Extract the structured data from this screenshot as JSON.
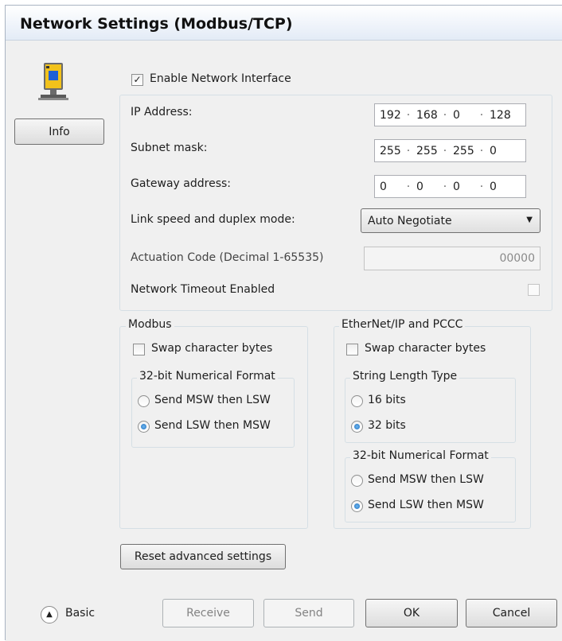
{
  "window": {
    "title": "Network Settings  (Modbus/TCP)"
  },
  "sidebar": {
    "info_label": "Info"
  },
  "network": {
    "enable_label": "Enable Network Interface",
    "enable_checked": true,
    "ip_label": "IP Address:",
    "ip": [
      "192",
      "168",
      "0",
      "128"
    ],
    "subnet_label": "Subnet mask:",
    "subnet": [
      "255",
      "255",
      "255",
      "0"
    ],
    "gateway_label": "Gateway address:",
    "gateway": [
      "0",
      "0",
      "0",
      "0"
    ],
    "link_label": "Link speed and duplex mode:",
    "link_value": "Auto Negotiate",
    "actuation_label": "Actuation Code (Decimal 1-65535)",
    "actuation_value": "00000",
    "timeout_label": "Network Timeout Enabled",
    "timeout_checked": false
  },
  "modbus": {
    "title": "Modbus",
    "swap_label": "Swap character bytes",
    "swap_checked": false,
    "format_title": "32-bit Numerical Format",
    "opt_msw": "Send MSW then LSW",
    "opt_lsw": "Send LSW then MSW",
    "selected": "lsw"
  },
  "ethernetip": {
    "title": "EtherNet/IP and PCCC",
    "swap_label": "Swap character bytes",
    "swap_checked": false,
    "string_title": "String Length Type",
    "opt_16": "16 bits",
    "opt_32": "32 bits",
    "string_selected": "32",
    "format_title": "32-bit Numerical Format",
    "opt_msw": "Send MSW then LSW",
    "opt_lsw": "Send LSW then MSW",
    "format_selected": "lsw"
  },
  "footer": {
    "reset_label": "Reset advanced settings",
    "basic_label": "Basic",
    "receive_label": "Receive",
    "send_label": "Send",
    "ok_label": "OK",
    "cancel_label": "Cancel"
  },
  "colors": {
    "accent": "#1e6fc0",
    "panel_border": "#d5dfe5",
    "background": "#f0f0f0"
  }
}
